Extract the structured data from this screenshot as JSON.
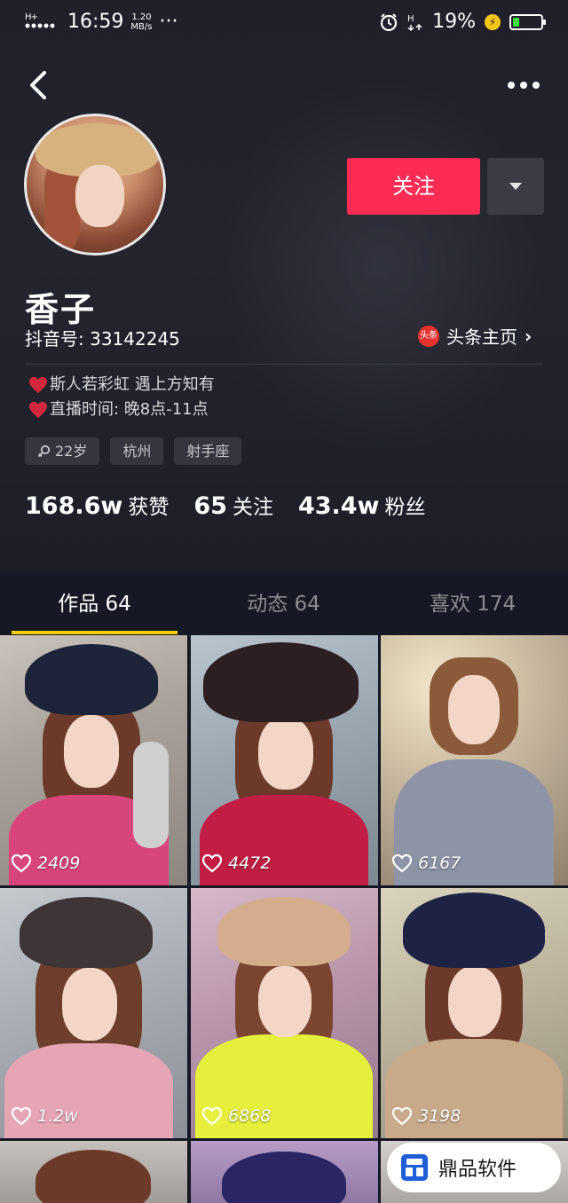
{
  "status_bar": {
    "time": "16:59",
    "net_speed_value": "1.20",
    "net_speed_unit": "MB/s",
    "more": "···",
    "battery": "19%",
    "signal_label": "H+"
  },
  "header": {
    "back_icon": "chevron-left-icon",
    "more_icon": "ellipsis-icon"
  },
  "profile": {
    "nickname": "香子",
    "douyin_id": "抖音号: 33142245",
    "toutiao_label": "头条主页",
    "toutiao_logo": "头条",
    "follow_label": "关注",
    "bio": [
      "斯人若彩虹 遇上方知有",
      "直播时间:  晚8点-11点"
    ],
    "tags": [
      {
        "label": "22岁",
        "icon": "female-icon"
      },
      {
        "label": "杭州"
      },
      {
        "label": "射手座"
      }
    ],
    "stats": [
      {
        "value": "168.6w",
        "label": "获赞"
      },
      {
        "value": "65",
        "label": "关注"
      },
      {
        "value": "43.4w",
        "label": "粉丝"
      }
    ]
  },
  "tabs": [
    {
      "label": "作品 64",
      "active": true
    },
    {
      "label": "动态 64",
      "active": false
    },
    {
      "label": "喜欢 174",
      "active": false
    }
  ],
  "videos": [
    {
      "likes": "2409"
    },
    {
      "likes": "4472"
    },
    {
      "likes": "6167"
    },
    {
      "likes": "1.2w"
    },
    {
      "likes": "6868"
    },
    {
      "likes": "3198"
    }
  ],
  "watermark": {
    "text": "鼎品软件"
  },
  "colors": {
    "accent": "#fe2c55",
    "tab_indicator": "#facd00",
    "background": "#161823"
  }
}
